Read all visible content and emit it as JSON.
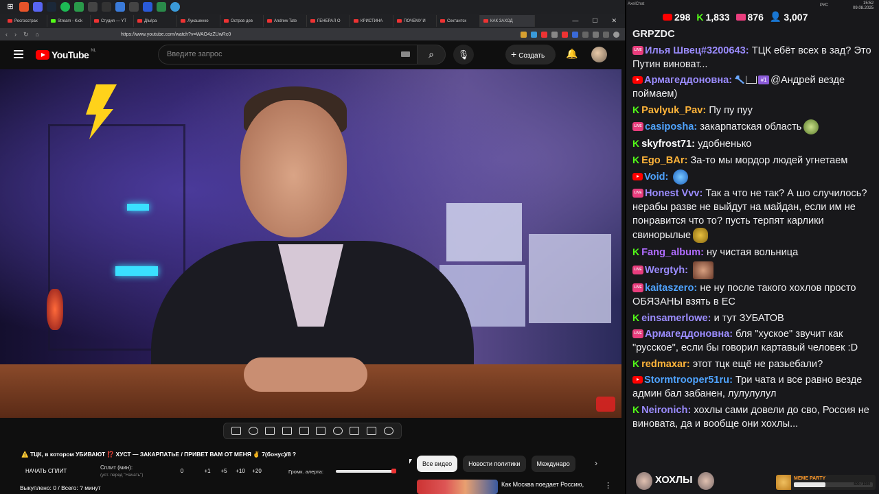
{
  "browser": {
    "tabs": [
      "Росгосстрах",
      "Stream - Kick",
      "Студия — YT",
      "Д!ы!ра",
      "Лукашенко",
      "Остров дев",
      "Andrew Tate",
      "ГЕНЕРАЛ О",
      "КРИСТИНА",
      "ПОЧЕМУ И",
      "Сектантск",
      "КАК ЗАХОД"
    ],
    "url": "https://www.youtube.com/watch?v=WAO4zZUwRc0",
    "window_controls": [
      "—",
      "☐",
      "✕"
    ]
  },
  "youtube": {
    "logo": "YouTube",
    "country": "NL",
    "search_placeholder": "Введите запрос",
    "create_label": "Создать",
    "chips": [
      "Все видео",
      "Новости политики",
      "Междунаро"
    ],
    "rec_title": "Как Москва поедает Россию,"
  },
  "panel": {
    "title": "⚠️ ТЦК, в котором УБИВАЮТ ⁉️ ХУСТ — ЗАКАРПАТЬЕ / ПРИВЕТ ВАМ ОТ МЕНЯ ✌️ 7(бонус)/8 ?",
    "start_split": "НАЧАТЬ СПЛИТ",
    "split_label": "Сплит (мин):",
    "split_sub": "(уст. перед \"Начать\")",
    "split_values": [
      "0",
      "+1",
      "+5",
      "+10",
      "+20"
    ],
    "volume_label": "Громк. алерта:",
    "volume_level": 0.97,
    "bought": "Выкуплено: 0 / Всего: ? минут"
  },
  "chat": {
    "app_name": "AxelChat",
    "stats": {
      "youtube": "298",
      "kick": "1,833",
      "live": "876",
      "viewers": "3,007"
    },
    "clock_time": "15:52",
    "clock_date": "09.08.2025",
    "tray_lang": "РУС",
    "top_line": "GRPZDC",
    "messages": [
      {
        "platform": "live",
        "user": "Илья Швец#3200643",
        "color": "#9b8cff",
        "text": "ТЦК ебёт всех в зад? Это Путин виноват...",
        "emote": ""
      },
      {
        "platform": "yt",
        "user": "Армагеддоновна",
        "color": "#9b8cff",
        "text": "@Андрей везде поймаем)",
        "emote": "",
        "badges": true,
        "rank": "#1"
      },
      {
        "platform": "kick",
        "user": "Pavlyuk_Pav",
        "color": "#ffb43a",
        "text": "Пу пу пуу",
        "emote": ""
      },
      {
        "platform": "live",
        "user": "casiposha",
        "color": "#4fa3ff",
        "text": "закарпатская область",
        "emote": "frog"
      },
      {
        "platform": "kick",
        "user": "skyfrost71",
        "color": "#ffffff",
        "text": "удобненько",
        "emote": ""
      },
      {
        "platform": "kick",
        "user": "Ego_BAr",
        "color": "#ffb43a",
        "text": "За-то мы мордор людей угнетаем",
        "emote": ""
      },
      {
        "platform": "yt",
        "user": "Void",
        "color": "#4fa3ff",
        "text": "",
        "emote": "blue"
      },
      {
        "platform": "live",
        "user": "Honest Vvv",
        "color": "#9b8cff",
        "text": "Так а что не так? А шо случилось? нерабы разве не выйдут на майдан, если им не понравится что то? пусть терпят карлики свинорылые",
        "emote": "sad"
      },
      {
        "platform": "kick",
        "user": "Fang_album",
        "color": "#b06cff",
        "text": "ну чистая вольница",
        "emote": ""
      },
      {
        "platform": "live",
        "user": "Wergtyh",
        "color": "#9b8cff",
        "text": "",
        "emote": "face"
      },
      {
        "platform": "live",
        "user": "kaitaszero",
        "color": "#4fa3ff",
        "text": "не ну после такого хохлов просто ОБЯЗАНЫ взять в ЕС",
        "emote": ""
      },
      {
        "platform": "kick",
        "user": "einsamerlowe",
        "color": "#9b8cff",
        "text": "и тут ЗУБАТОВ",
        "emote": ""
      },
      {
        "platform": "live",
        "user": "Армагеддоновна",
        "color": "#9b8cff",
        "text": "бля \"хуское\" звучит как \"русское\", если бы говорил картавый человек :D",
        "emote": ""
      },
      {
        "platform": "kick",
        "user": "redmaxar",
        "color": "#ffb43a",
        "text": "этот тцк ещё не разьебали?",
        "emote": ""
      },
      {
        "platform": "yt",
        "user": "Stormtrooper51ru",
        "color": "#4fa3ff",
        "text": "Три чата и все равно везде админ бал забанен, лулулулул",
        "emote": ""
      },
      {
        "platform": "kick",
        "user": "Neironich",
        "color": "#9b8cff",
        "text": "хохлы сами довели до сво, Россия не виновата, да и вообще они хохлы...",
        "emote": ""
      }
    ],
    "bottom_text": "ХОХЛЫ",
    "meme_label": "MEME PARTY",
    "meme_count": "600 / 1500",
    "meme_progress": 0.4
  }
}
